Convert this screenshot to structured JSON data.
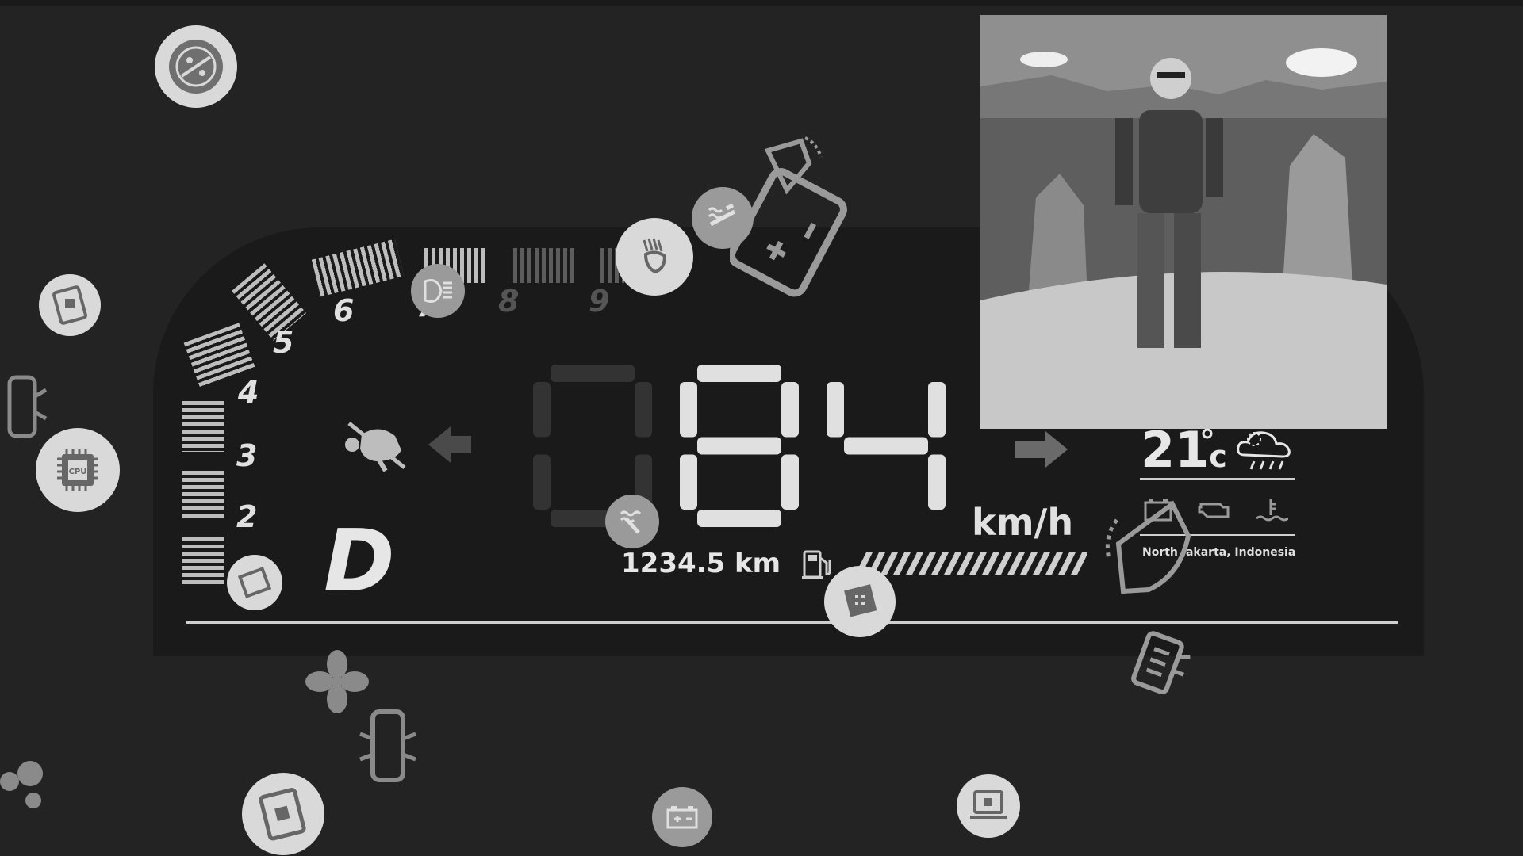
{
  "rpm_labels": [
    "2",
    "3",
    "4",
    "5",
    "6",
    "7",
    "8",
    "9"
  ],
  "gear": "D",
  "speed": {
    "digits": "084",
    "unit": "km/h"
  },
  "odometer": "1234.5 km",
  "weather": {
    "temperature": "21",
    "unit": "c",
    "location": "North Jakarta, Indonesia"
  },
  "colors": {
    "background": "#232323",
    "panel": "#1a1a1a",
    "active": "#bdbdbd",
    "inactive": "#5c5c5c",
    "icon_badge": "#d9d9d9"
  },
  "icons": [
    "seatbelt-warning-icon",
    "left-turn-signal-icon",
    "right-turn-signal-icon",
    "fuel-icon",
    "weather-rain-icon",
    "battery-warning-icon",
    "engine-check-icon",
    "coolant-temp-icon",
    "wiper-icon",
    "headlight-icon",
    "high-beam-icon",
    "cpu-chip-icon",
    "tablet-chip-icon",
    "car-door-icon",
    "fan-icon",
    "circuit-icon",
    "laptop-chip-icon"
  ]
}
